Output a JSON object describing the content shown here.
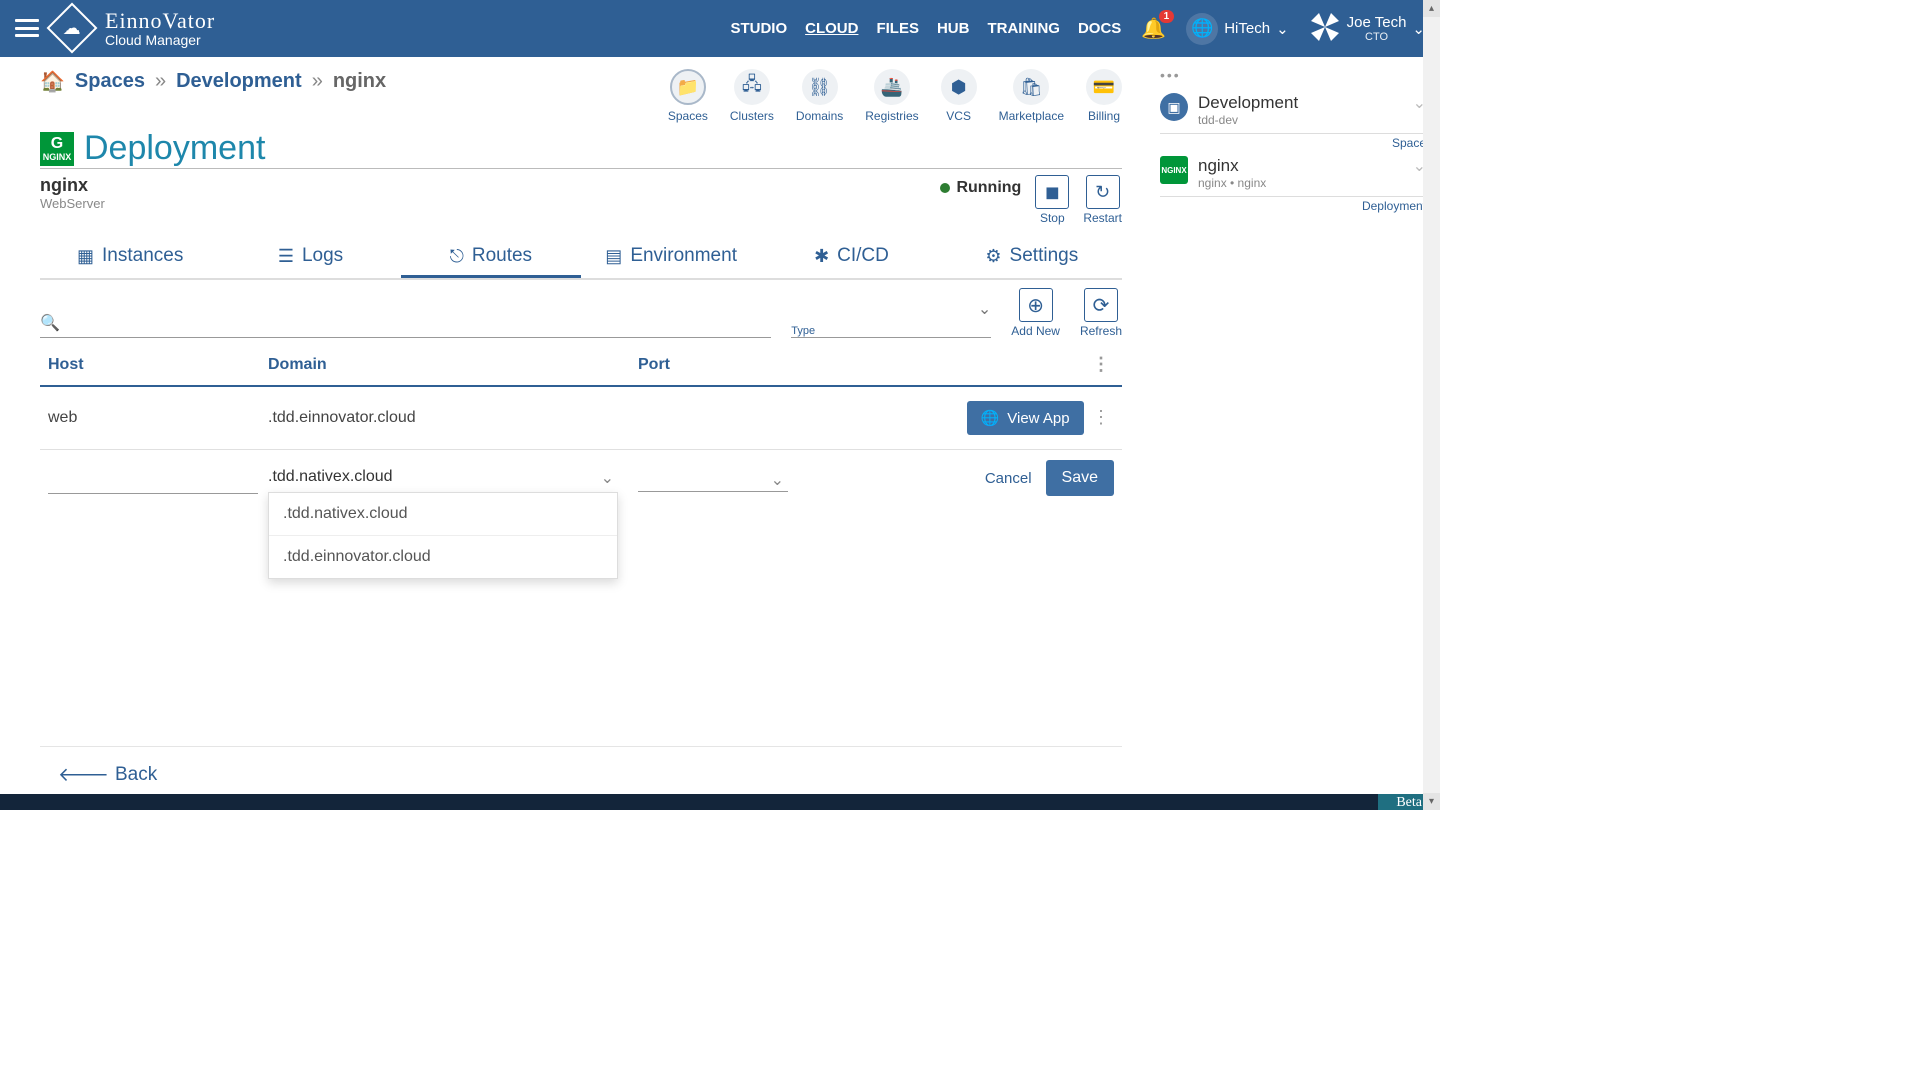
{
  "brand": {
    "top": "EinnoVator",
    "sub": "Cloud Manager"
  },
  "nav": [
    "STUDIO",
    "CLOUD",
    "FILES",
    "HUB",
    "TRAINING",
    "DOCS"
  ],
  "nav_active": "CLOUD",
  "notif_count": "1",
  "org": "HiTech",
  "user": {
    "name": "Joe Tech",
    "role": "CTO"
  },
  "breadcrumb": {
    "space": "Spaces",
    "dev": "Development",
    "current": "nginx"
  },
  "quicknav": [
    {
      "label": "Spaces",
      "icon": "📁"
    },
    {
      "label": "Clusters",
      "icon": "🖧"
    },
    {
      "label": "Domains",
      "icon": "⛓"
    },
    {
      "label": "Registries",
      "icon": "🚢"
    },
    {
      "label": "VCS",
      "icon": "⬢"
    },
    {
      "label": "Marketplace",
      "icon": "🛍"
    },
    {
      "label": "Billing",
      "icon": "💳"
    }
  ],
  "page_title": "Deployment",
  "deploy": {
    "name": "nginx",
    "sub": "WebServer"
  },
  "status": "Running",
  "actions": {
    "stop": "Stop",
    "restart": "Restart"
  },
  "tabs": [
    "Instances",
    "Logs",
    "Routes",
    "Environment",
    "CI/CD",
    "Settings"
  ],
  "tab_active": "Routes",
  "filter": {
    "type_label": "Type"
  },
  "toolbar": {
    "addnew": "Add New",
    "refresh": "Refresh"
  },
  "table": {
    "headers": {
      "host": "Host",
      "domain": "Domain",
      "port": "Port"
    },
    "rows": [
      {
        "host": "web",
        "domain": ".tdd.einnovator.cloud",
        "port": "",
        "view": "View App"
      }
    ]
  },
  "newrow": {
    "domain_value": ".tdd.nativex.cloud",
    "options": [
      ".tdd.nativex.cloud",
      ".tdd.einnovator.cloud"
    ],
    "cancel": "Cancel",
    "save": "Save"
  },
  "back": "Back",
  "sidebar": {
    "items": [
      {
        "title": "Development",
        "sub": "tdd-dev",
        "tag": "Space",
        "icon": "box"
      },
      {
        "title": "nginx",
        "sub": "nginx • nginx",
        "tag": "Deployment",
        "icon": "nginx"
      }
    ]
  },
  "footer": {
    "beta": "Beta"
  }
}
